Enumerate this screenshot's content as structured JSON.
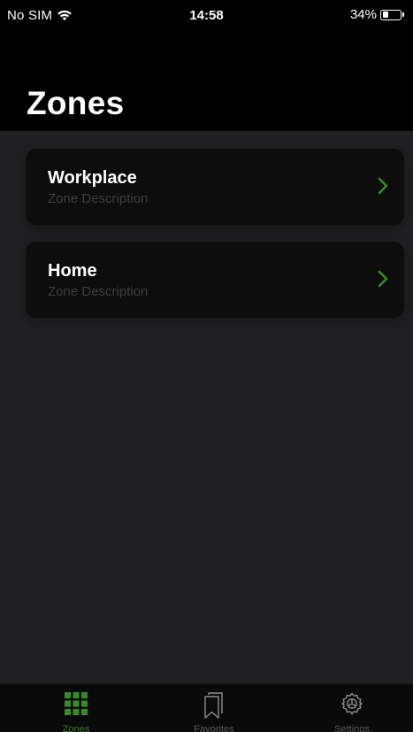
{
  "status_bar": {
    "carrier": "No SIM",
    "time": "14:58",
    "battery": "34%"
  },
  "header": {
    "title": "Zones"
  },
  "zones": [
    {
      "name": "Workplace",
      "description": "Zone Description"
    },
    {
      "name": "Home",
      "description": "Zone Description"
    }
  ],
  "tab_bar": {
    "tabs": [
      {
        "label": "Zones",
        "icon": "grid-icon",
        "active": true
      },
      {
        "label": "Favorites",
        "icon": "bookmarks-icon",
        "active": false
      },
      {
        "label": "Settings",
        "icon": "gear-icon",
        "active": false
      }
    ]
  },
  "colors": {
    "accent": "#3a8a25",
    "background": "#202022",
    "card": "#0d0d0e"
  }
}
